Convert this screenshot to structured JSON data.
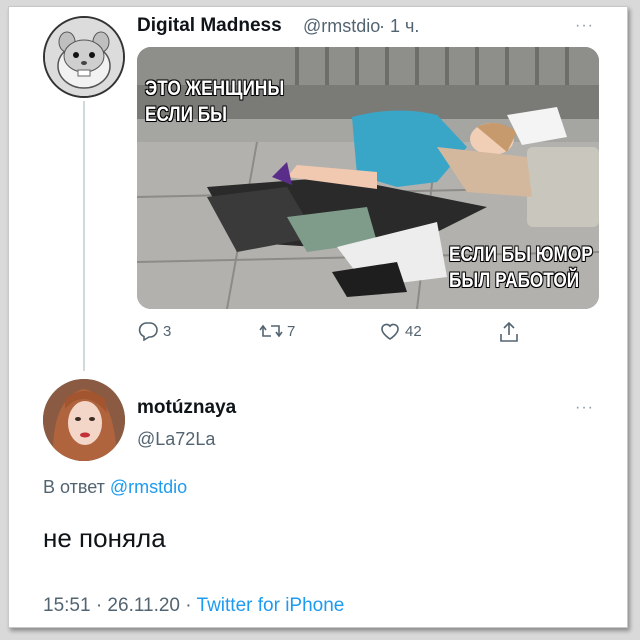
{
  "tweet1": {
    "author_name": "Digital Madness",
    "handle": "@rmstdio",
    "separator": "·",
    "time": "1 ч.",
    "more_label": "···",
    "avatar_icon": "hamster-avatar-icon",
    "meme": {
      "caption_top_line1": "ЭТО ЖЕНЩИНЫ",
      "caption_top_line2": "ЕСЛИ БЫ",
      "caption_bottom_line1": "ЕСЛИ БЫ ЮМОР",
      "caption_bottom_line2": "БЫЛ РАБОТОЙ"
    },
    "actions": {
      "reply_count": "3",
      "retweet_count": "7",
      "like_count": "42"
    }
  },
  "tweet2": {
    "author_name": "motúznaya",
    "handle": "@La72La",
    "more_label": "···",
    "reply_prefix": "В ответ",
    "reply_mention": "@rmstdio",
    "text": "не поняла",
    "timestamp": "15:51 · 26.11.20 ·",
    "source": "Twitter for iPhone"
  },
  "colors": {
    "accent": "#1d9bf0",
    "secondary_text": "#536471",
    "primary_text": "#0f1419"
  }
}
